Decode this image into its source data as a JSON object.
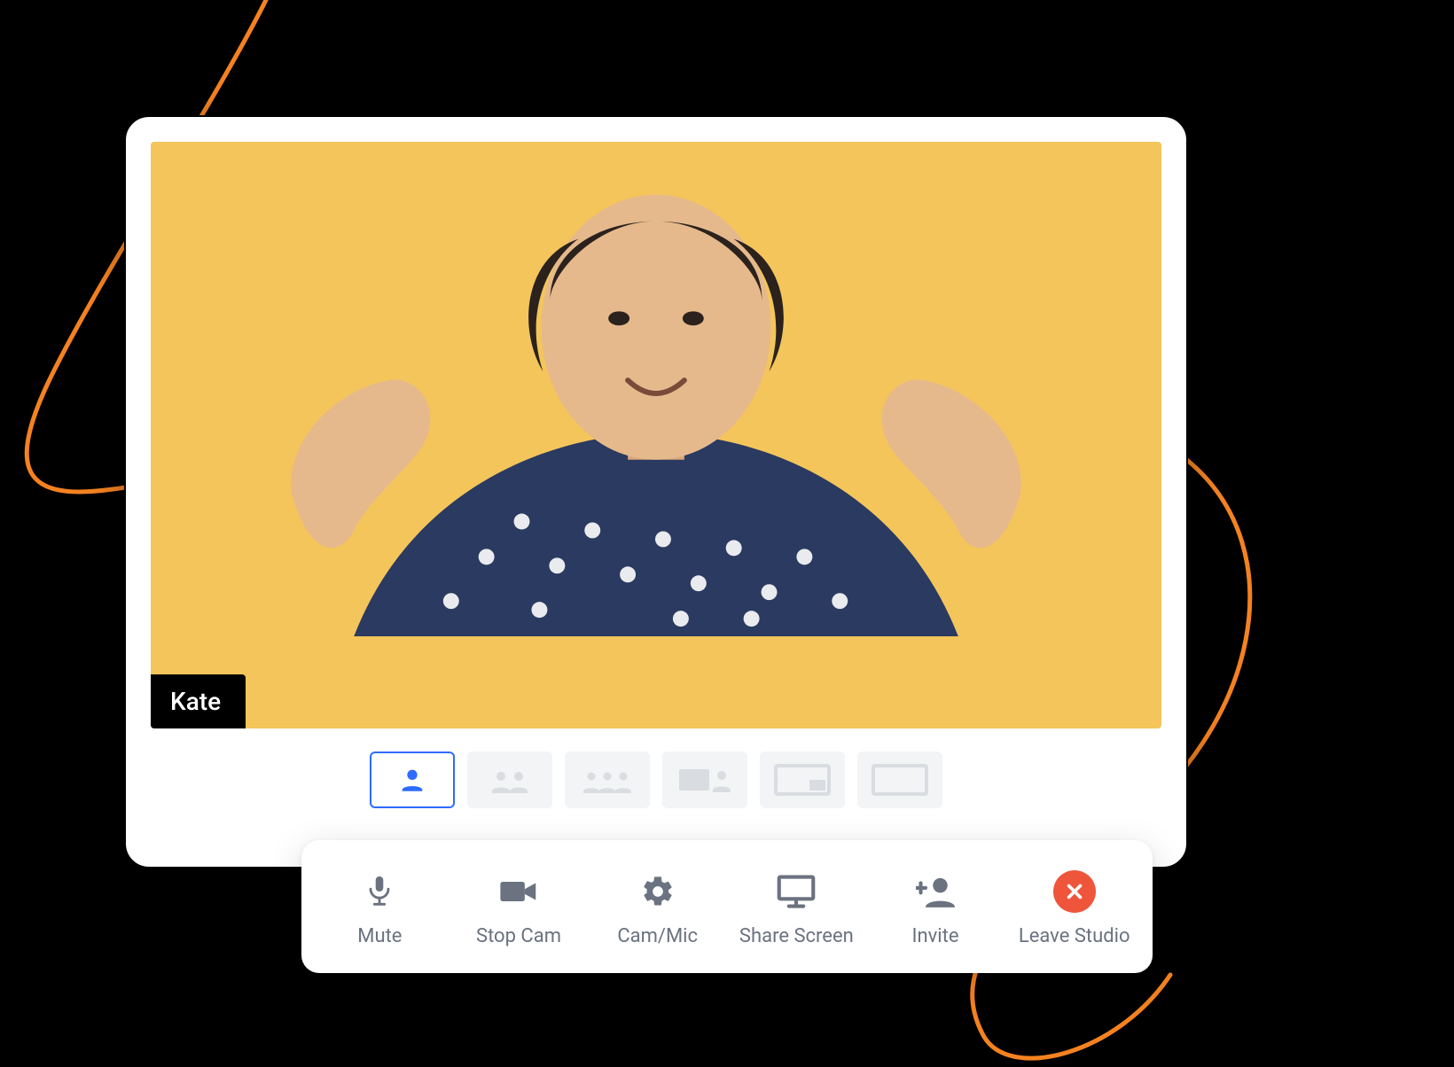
{
  "participant": {
    "name": "Kate"
  },
  "layouts": {
    "selected_index": 0,
    "count": 6
  },
  "toolbar": {
    "mute": {
      "label": "Mute"
    },
    "stopcam": {
      "label": "Stop Cam"
    },
    "cammic": {
      "label": "Cam/Mic"
    },
    "share": {
      "label": "Share Screen"
    },
    "invite": {
      "label": "Invite"
    },
    "leave": {
      "label": "Leave Studio"
    }
  },
  "colors": {
    "accent": "#2e6bff",
    "video_bg": "#f4c55a",
    "leave": "#ef553b",
    "swoosh": "#f58220"
  }
}
